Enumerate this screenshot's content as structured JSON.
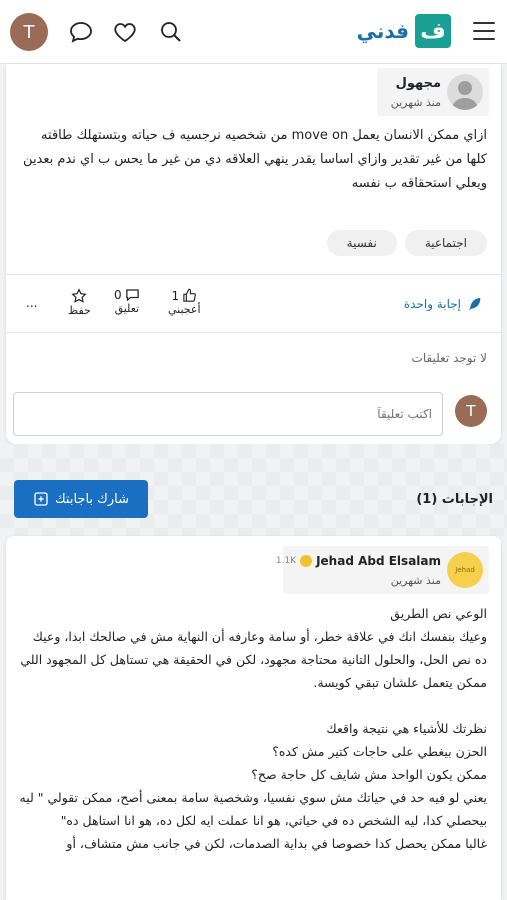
{
  "header": {
    "avatar_letter": "T",
    "logo_text": "فدني",
    "logo_mark": "ف",
    "icons": [
      "chat-icon",
      "heart-icon",
      "search-icon",
      "menu-icon"
    ]
  },
  "question": {
    "author_name": "مجهول",
    "author_time": "منذ شهرين",
    "text": "ازاي ممكن الانسان يعمل move on من شخصيه نرجسيه ف حياته وبتستهلك طاقته كلها من غير تقدير وازاي اساسا يقدر ينهي العلاقه دي من غير ما يحس ب اي ندم بعدين ويعلي استحقاقه ب نفسه",
    "tags": [
      "اجتماعية",
      "نفسية"
    ],
    "answers_link": "إجابة واحدة",
    "likes_count": "1",
    "likes_label": "أعجبني",
    "comments_count": "0",
    "comments_label": "تعليق",
    "save_label": "حفظ",
    "more_label": "...",
    "no_comments": "لا توجد تعليقات",
    "comment_avatar_letter": "T",
    "comment_placeholder": "اكتب تعليقاً"
  },
  "answers_section": {
    "share_button": "شارك باجابتك",
    "title": "الإجابات (1)"
  },
  "answer": {
    "author_name": "Jehad Abd Elsalam",
    "author_score": "1.1K",
    "author_time": "منذ شهرين",
    "avatar_text": "Jehad",
    "paragraphs": [
      "الوعي نص الطريق",
      "وعيك بنفسك انك في علاقة خطر، أو سامة وعارفه أن النهاية مش في صالحك ابدا، وعيك ده نص الحل، والحلول التانية محتاجة مجهود، لكن في الحقيقة هي تستاهل كل المجهود اللي ممكن يتعمل علشان تبقي كويسة.",
      "",
      "نظرتك للأشياء هي نتيجة واقعك",
      "الحزن بيغطي على حاجات كتير مش كده؟",
      "ممكن يكون الواحد مش شايف كل حاجة صح؟",
      "يعني لو فيه حد في حياتك مش سوي نفسيا، وشخصية سامة بمعنى أصح، ممكن تقولي \" ليه بيحصلي كدا، ليه الشخص ده في حياتي، هو انا عملت ايه لكل ده، هو انا استاهل ده\"",
      "غالبا ممكن يحصل كدا خصوصا في بداية الصدمات، لكن في جانب مش متشاف، أو"
    ]
  }
}
